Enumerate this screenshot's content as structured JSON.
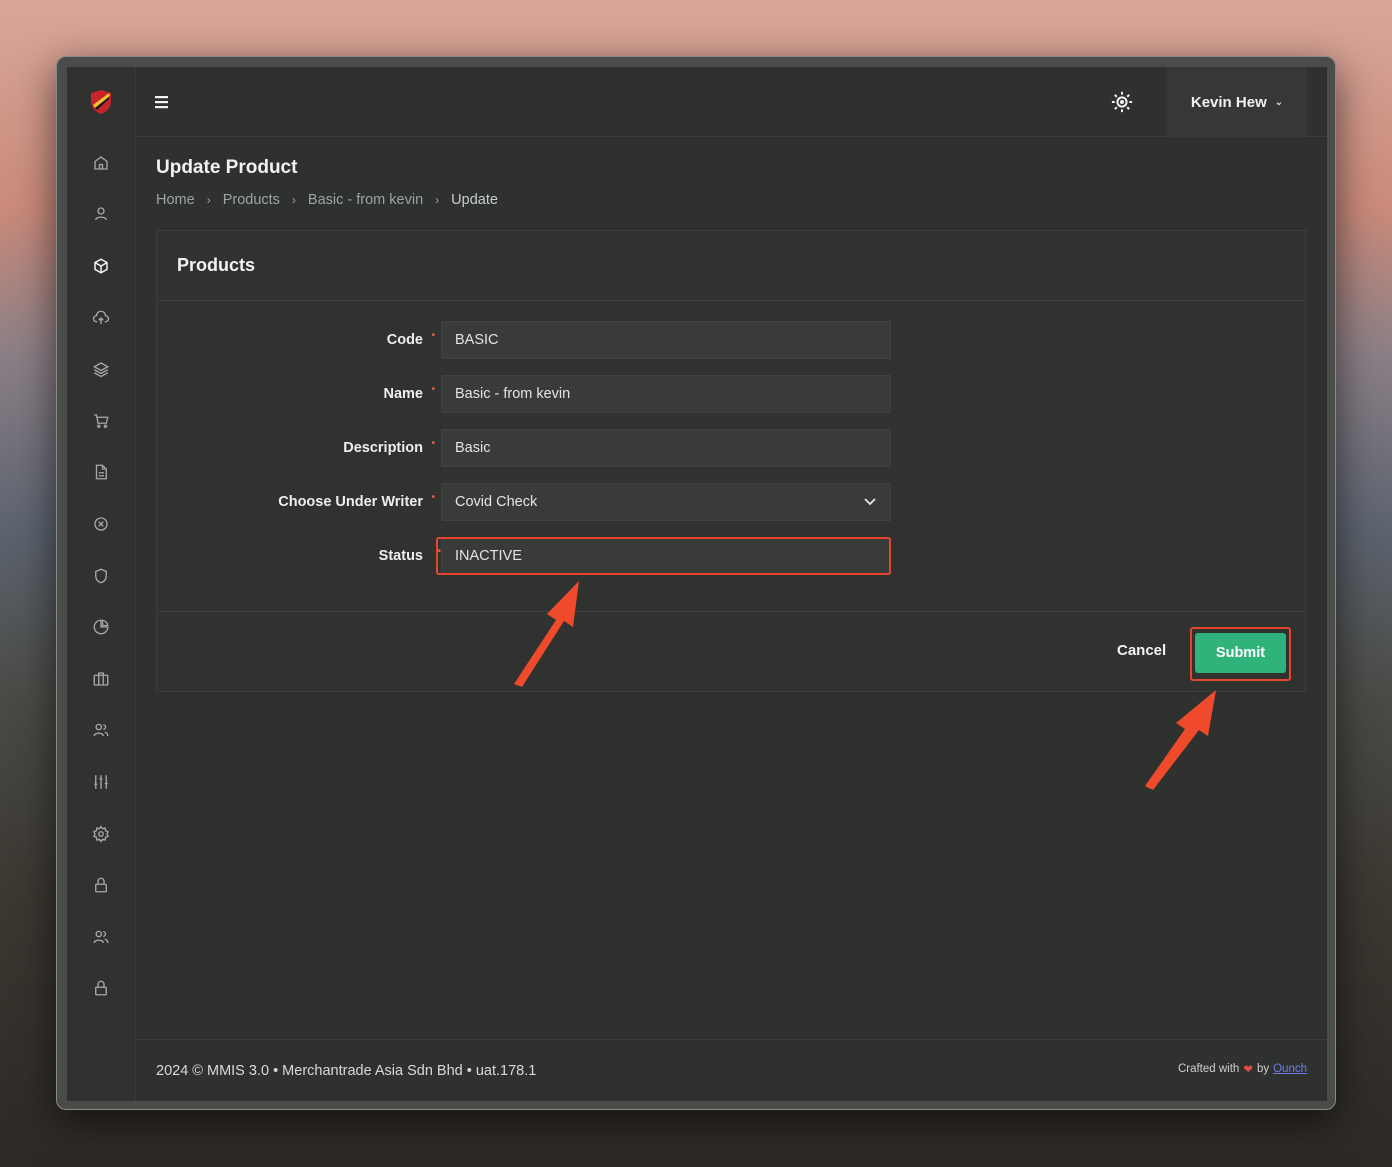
{
  "topbar": {
    "user_name": "Kevin Hew"
  },
  "sidebar": {
    "items": [
      {
        "icon": "home-icon"
      },
      {
        "icon": "user-icon"
      },
      {
        "icon": "cube-icon",
        "active": true
      },
      {
        "icon": "cloud-upload-icon"
      },
      {
        "icon": "layers-icon"
      },
      {
        "icon": "cart-icon"
      },
      {
        "icon": "document-icon"
      },
      {
        "icon": "x-circle-icon"
      },
      {
        "icon": "shield-icon"
      },
      {
        "icon": "pie-chart-icon"
      },
      {
        "icon": "briefcase-icon"
      },
      {
        "icon": "users-icon"
      },
      {
        "icon": "sliders-icon"
      },
      {
        "icon": "gear-icon"
      },
      {
        "icon": "lock-icon"
      },
      {
        "icon": "users-icon"
      },
      {
        "icon": "lock-icon"
      }
    ]
  },
  "page": {
    "title": "Update Product",
    "breadcrumb": [
      "Home",
      "Products",
      "Basic - from kevin",
      "Update"
    ]
  },
  "card": {
    "title": "Products",
    "fields": {
      "code": {
        "label": "Code",
        "value": "BASIC"
      },
      "name": {
        "label": "Name",
        "value": "Basic - from kevin"
      },
      "description": {
        "label": "Description",
        "value": "Basic"
      },
      "underwriter": {
        "label": "Choose Under Writer",
        "value": "Covid Check"
      },
      "status": {
        "label": "Status",
        "value": "INACTIVE"
      }
    },
    "cancel_label": "Cancel",
    "submit_label": "Submit"
  },
  "footer": {
    "left": "2024 © MMIS 3.0 • Merchantrade Asia Sdn Bhd • uat.178.1",
    "crafted": "Crafted with",
    "by": "by",
    "link": "Ounch"
  },
  "colors": {
    "accent_green": "#2fb37a",
    "annotation_red": "#e5452e",
    "app_bg": "#2f312f"
  }
}
